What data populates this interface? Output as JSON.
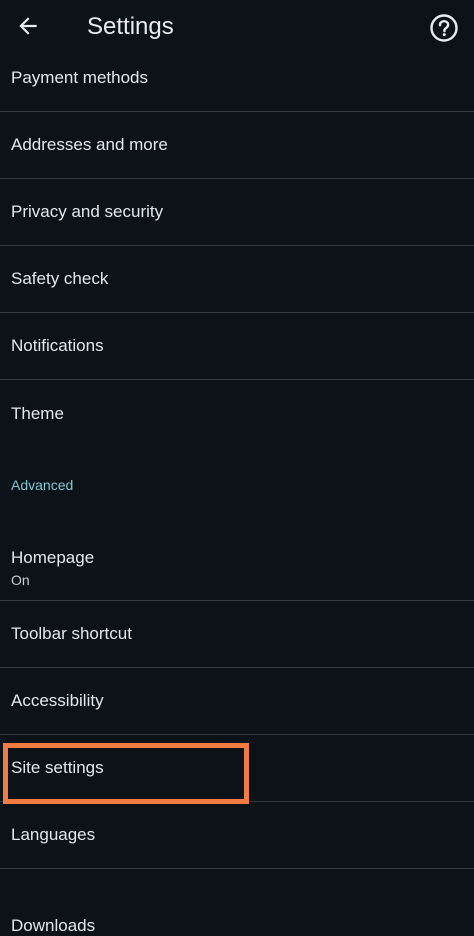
{
  "header": {
    "title": "Settings",
    "back_icon": "arrow-left-icon",
    "help_icon": "help-circle-icon"
  },
  "items": [
    {
      "label": "Payment methods"
    },
    {
      "label": "Addresses and more"
    },
    {
      "label": "Privacy and security"
    },
    {
      "label": "Safety check"
    },
    {
      "label": "Notifications"
    },
    {
      "label": "Theme"
    }
  ],
  "advanced": {
    "header": "Advanced",
    "homepage": {
      "label": "Homepage",
      "sub": "On"
    },
    "items": [
      {
        "label": "Toolbar shortcut"
      },
      {
        "label": "Accessibility"
      },
      {
        "label": "Site settings"
      },
      {
        "label": "Languages"
      },
      {
        "label": "Downloads"
      }
    ]
  },
  "colors": {
    "background": "#0c1318",
    "accent": "#7fc6d6",
    "highlight": "#f07b45",
    "divider": "#333b41"
  }
}
